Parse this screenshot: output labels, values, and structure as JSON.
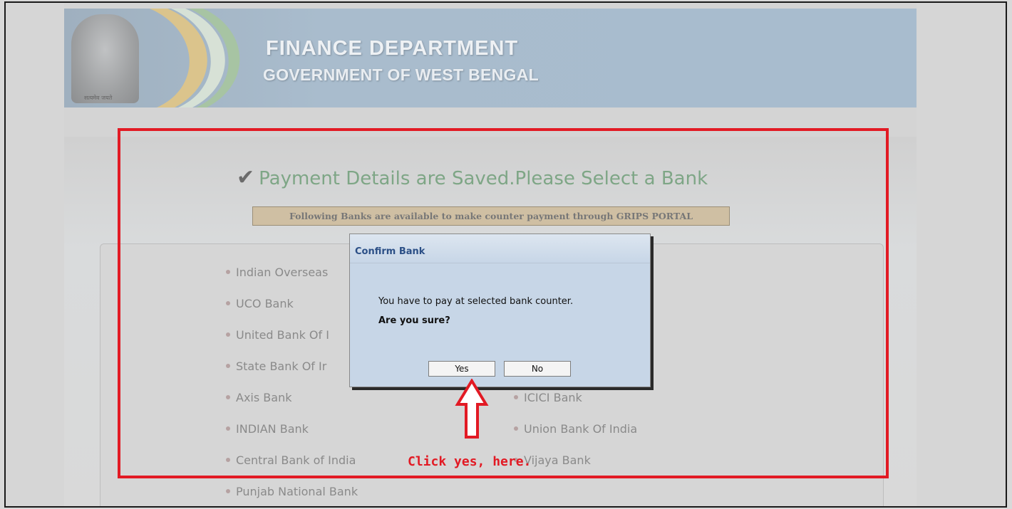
{
  "banner": {
    "title": "FINANCE DEPARTMENT",
    "subtitle": "GOVERNMENT OF WEST BENGAL",
    "emblem_caption": "सत्यमेव जयते"
  },
  "main": {
    "success_message": "Payment Details are Saved.Please Select a Bank",
    "notice": "Following Banks are available to make counter payment through GRIPS PORTAL",
    "banks_left": [
      "Indian Overseas",
      "UCO Bank",
      "United Bank Of I",
      "State Bank Of Ir",
      "Axis Bank",
      "INDIAN Bank",
      "Central Bank of India",
      "Punjab National Bank"
    ],
    "banks_right": [
      "ICICI Bank",
      "Union Bank Of India",
      "Vijaya Bank"
    ]
  },
  "dialog": {
    "title": "Confirm Bank",
    "message": "You have to pay at selected bank counter.",
    "question": "Are you sure?",
    "yes_label": "Yes",
    "no_label": "No"
  },
  "annotation": {
    "text": "Click yes, here.",
    "color": "#e21a24"
  },
  "colors": {
    "success_text": "#7ea686",
    "dialog_title": "#2b4f86",
    "dialog_bg": "#c7d6e7"
  }
}
